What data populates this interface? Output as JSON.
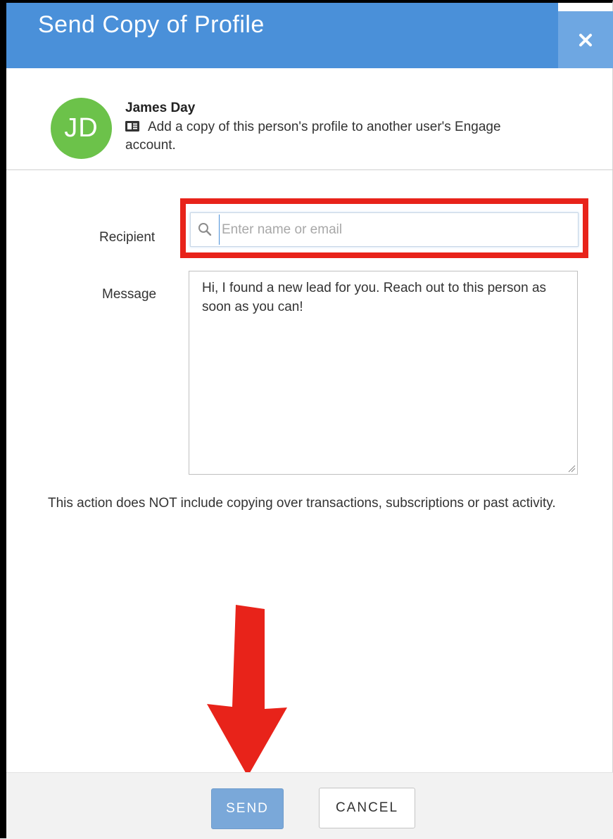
{
  "dialog": {
    "title": "Send Copy of Profile",
    "close_icon": "close-icon"
  },
  "person": {
    "initials": "JD",
    "name": "James Day",
    "icon": "contact-card-icon",
    "description": "Add a copy of this person's profile to another user's Engage account.",
    "avatar_color": "#6cc24a"
  },
  "form": {
    "recipient_label": "Recipient",
    "recipient_placeholder": "Enter name or email",
    "recipient_value": "",
    "search_icon": "search-icon",
    "message_label": "Message",
    "message_value": "Hi, I found a new lead for you. Reach out to this person as soon as you can!"
  },
  "notice": "This action does NOT include copying over transactions, subscriptions or past activity.",
  "footer": {
    "send_label": "SEND",
    "cancel_label": "CANCEL"
  },
  "colors": {
    "header": "#4a90d9",
    "close_button": "#6ea7e2",
    "highlight": "#e8231a",
    "annotation_arrow": "#e8231a",
    "send_button": "#7aa8d9"
  }
}
